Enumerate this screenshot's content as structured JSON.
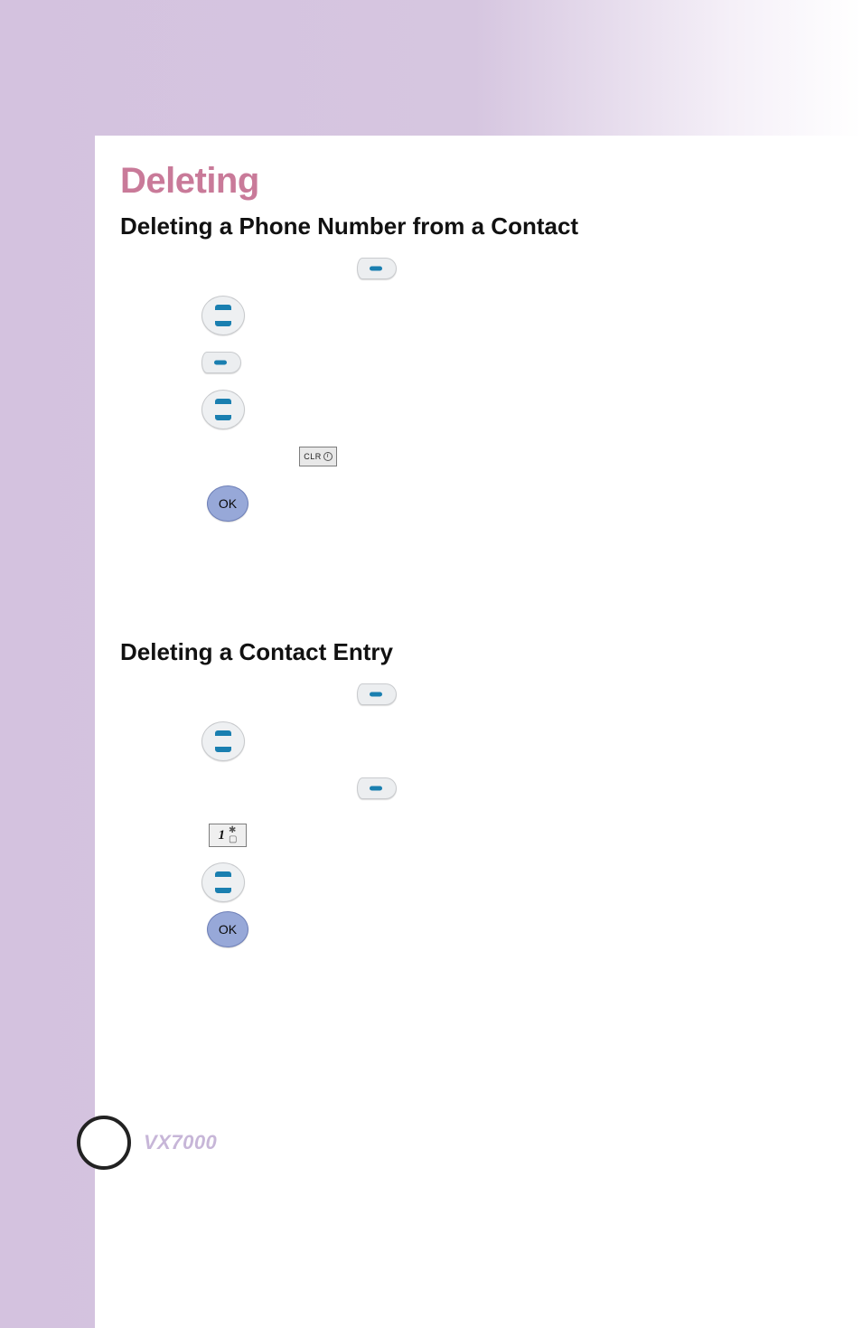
{
  "doc": {
    "title": "Deleting",
    "model": "VX7000"
  },
  "section1": {
    "title": "Deleting a Phone Number from a Contact",
    "ok_label": "OK",
    "clr_label": "CLR"
  },
  "section2": {
    "title": "Deleting a Contact Entry",
    "ok_label": "OK",
    "numkey_digit": "1"
  }
}
